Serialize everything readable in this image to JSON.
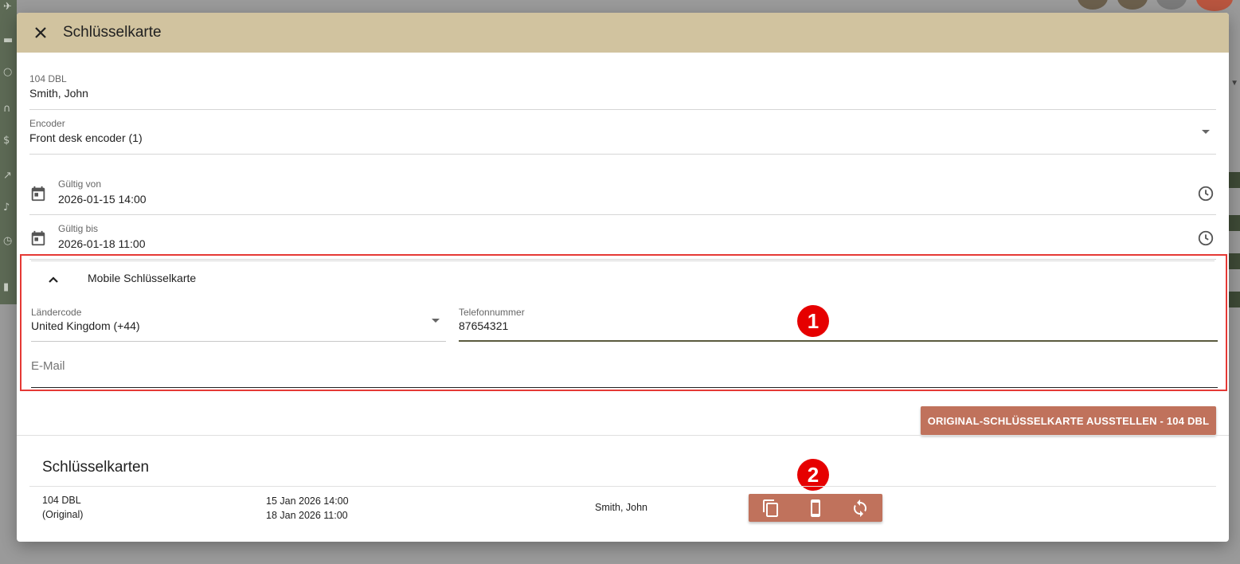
{
  "dialog": {
    "title": "Schlüsselkarte"
  },
  "room": {
    "label": "104 DBL",
    "guest": "Smith, John"
  },
  "encoder": {
    "label": "Encoder",
    "value": "Front desk encoder (1)"
  },
  "valid_from": {
    "label": "Gültig von",
    "value": "2026-01-15 14:00"
  },
  "valid_to": {
    "label": "Gültig bis",
    "value": "2026-01-18 11:00"
  },
  "mobile_key": {
    "title": "Mobile Schlüsselkarte",
    "country_code": {
      "label": "Ländercode",
      "value": "United Kingdom (+44)"
    },
    "phone": {
      "label": "Telefonnummer",
      "value": "87654321"
    },
    "email": {
      "placeholder": "E-Mail"
    }
  },
  "issue_button": {
    "label": "ORIGINAL-SCHLÜSSELKARTE AUSSTELLEN - 104 DBL"
  },
  "key_cards": {
    "title": "Schlüsselkarten",
    "rows": [
      {
        "room": "104 DBL",
        "type": "(Original)",
        "from": "15 Jan 2026 14:00",
        "to": "18 Jan 2026 11:00",
        "guest": "Smith, John"
      }
    ]
  },
  "markers": [
    "1",
    "2"
  ],
  "colors": {
    "header": "#d1c39f",
    "accent_button": "#c0725c",
    "highlight_border": "#e53935",
    "marker": "#e60000"
  },
  "icons": [
    "close-icon",
    "calendar-icon",
    "clock-icon",
    "chevron-up-icon",
    "dropdown-arrow-icon",
    "copy-icon",
    "mobile-phone-icon",
    "sync-icon"
  ]
}
